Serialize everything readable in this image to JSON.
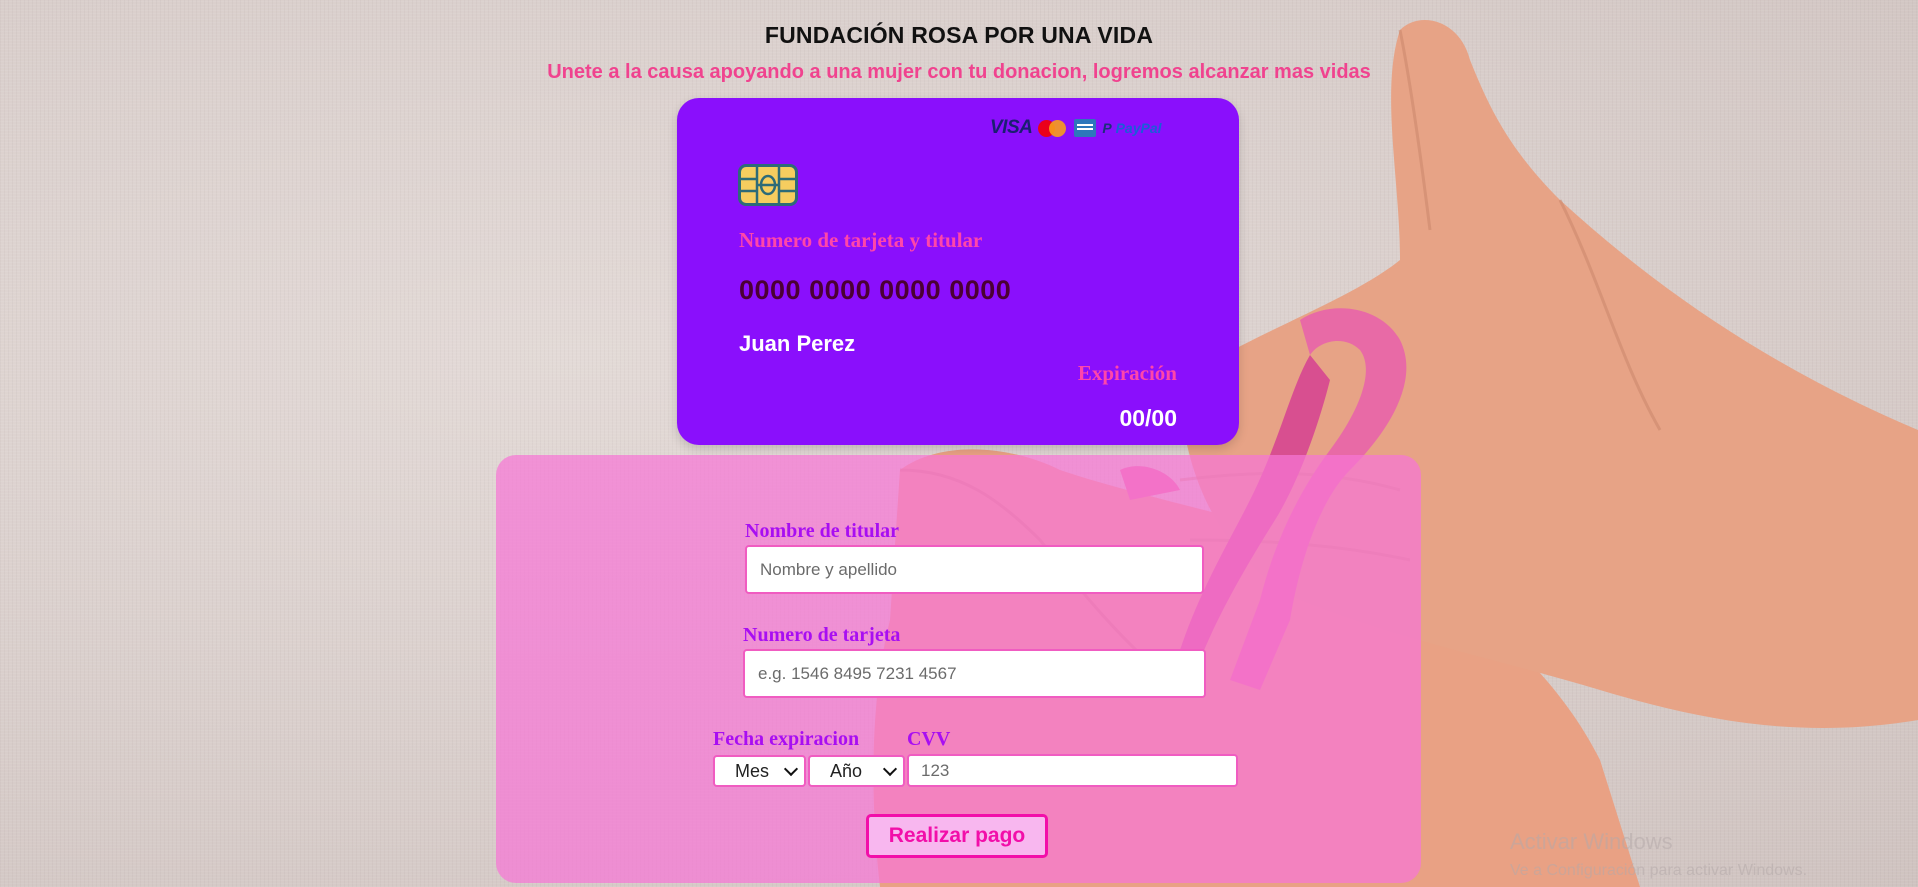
{
  "header": {
    "title": "FUNDACIÓN ROSA POR UNA VIDA",
    "subtitle": "Unete a la causa apoyando a una mujer con tu donacion, logremos alcanzar mas vidas"
  },
  "card": {
    "brands": [
      "VISA",
      "mastercard-icon",
      "amex-icon",
      "PayPal"
    ],
    "label": "Numero de tarjeta y titular",
    "number": "0000 0000 0000 0000",
    "holder": "Juan Perez",
    "expiry_label": "Expiración",
    "expiry": "00/00",
    "colors": {
      "background": "#8a0ffc",
      "accent": "#ff46a9"
    }
  },
  "form": {
    "holder_label": "Nombre de titular",
    "holder_placeholder": "Nombre y apellido",
    "number_label": "Numero de tarjeta",
    "number_placeholder": "e.g. 1546 8495 7231 4567",
    "expiry_label": "Fecha expiracion",
    "month_select": "Mes",
    "year_select": "Año",
    "cvv_label": "CVV",
    "cvv_placeholder": "123",
    "submit_label": "Realizar pago"
  },
  "watermark": {
    "line1": "Activar Windows",
    "line2": "Ve a Configuración para activar Windows."
  }
}
